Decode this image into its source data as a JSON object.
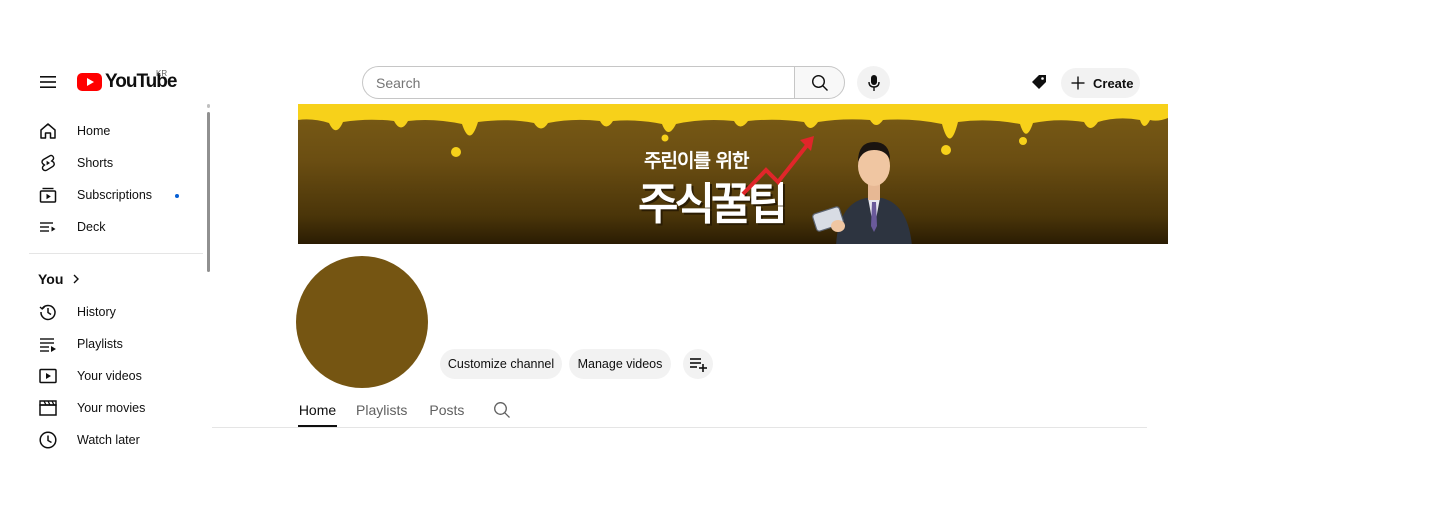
{
  "header": {
    "logo_text": "YouTube",
    "country_code": "KR",
    "search_placeholder": "Search",
    "create_label": "Create",
    "icons": [
      "menu-icon",
      "youtube-logo-icon",
      "search-icon",
      "mic-icon",
      "tag-icon",
      "plus-icon"
    ]
  },
  "sidebar": {
    "main_items": [
      {
        "label": "Home",
        "icon": "home-icon"
      },
      {
        "label": "Shorts",
        "icon": "shorts-icon"
      },
      {
        "label": "Subscriptions",
        "icon": "subscriptions-icon",
        "has_new_indicator": true
      },
      {
        "label": "Deck",
        "icon": "deck-icon"
      }
    ],
    "you_heading": "You",
    "you_items": [
      {
        "label": "History",
        "icon": "history-icon"
      },
      {
        "label": "Playlists",
        "icon": "playlists-icon"
      },
      {
        "label": "Your videos",
        "icon": "your-videos-icon"
      },
      {
        "label": "Your movies",
        "icon": "movies-icon"
      },
      {
        "label": "Watch later",
        "icon": "clock-icon"
      }
    ]
  },
  "banner": {
    "subtitle": "주린이를 위한",
    "title": "주식꿀팁",
    "colors": {
      "honey": "#f7d11a",
      "background": "#6b4e12",
      "arrow": "#e0262a"
    }
  },
  "channel": {
    "avatar_color": "#755512",
    "buttons": {
      "customize": "Customize channel",
      "manage": "Manage videos"
    },
    "tabs": [
      {
        "label": "Home",
        "active": true
      },
      {
        "label": "Playlists",
        "active": false
      },
      {
        "label": "Posts",
        "active": false
      }
    ]
  },
  "colors": {
    "youtube_red": "#ff0000",
    "indicator_blue": "#065fd4",
    "chip_bg": "#f2f2f2"
  }
}
